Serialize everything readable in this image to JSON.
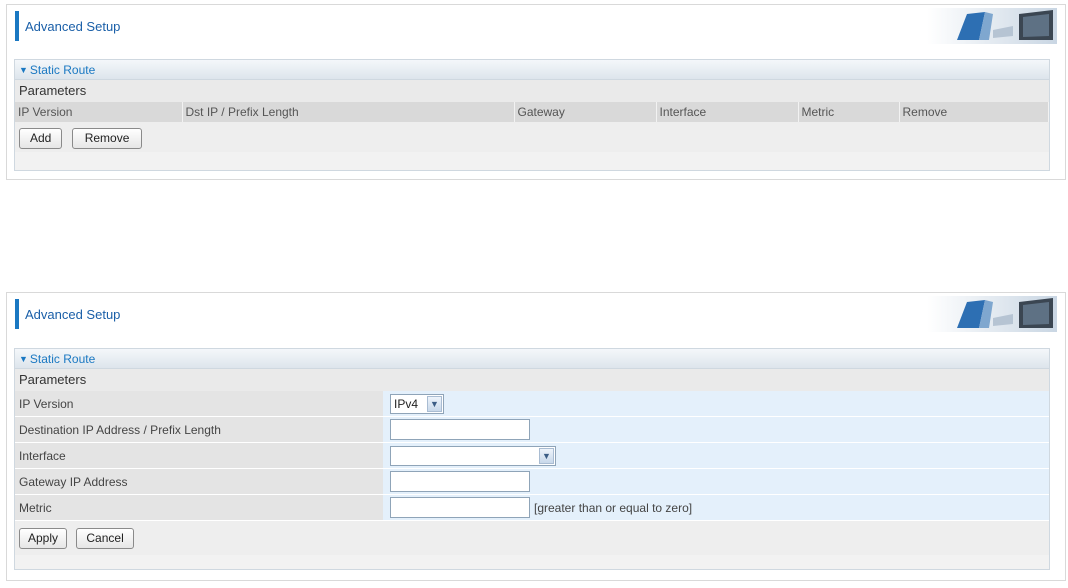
{
  "screens": [
    {
      "header_title": "Advanced Setup",
      "section_title": "Static Route",
      "params_label": "Parameters",
      "columns": [
        "IP Version",
        "Dst IP / Prefix Length",
        "Gateway",
        "Interface",
        "Metric",
        "Remove"
      ],
      "buttons": {
        "add": "Add",
        "remove": "Remove"
      }
    },
    {
      "header_title": "Advanced Setup",
      "section_title": "Static Route",
      "params_label": "Parameters",
      "fields": {
        "ip_version": {
          "label": "IP Version",
          "value": "IPv4"
        },
        "dst_ip": {
          "label": "Destination IP Address / Prefix Length",
          "value": ""
        },
        "interface": {
          "label": "Interface",
          "value": ""
        },
        "gateway": {
          "label": "Gateway IP Address",
          "value": ""
        },
        "metric": {
          "label": "Metric",
          "value": "",
          "hint": "[greater than or equal to zero]"
        }
      },
      "buttons": {
        "apply": "Apply",
        "cancel": "Cancel"
      }
    }
  ],
  "icons": {
    "expand": "triangle-down-icon",
    "dropdown": "chevron-down-icon",
    "header_art": "computer-monitor-icon"
  },
  "colors": {
    "accent": "#1a78c2",
    "title": "#1a5fa8",
    "field_bg": "#e4f0fb",
    "label_bg": "#e4e4e4"
  }
}
